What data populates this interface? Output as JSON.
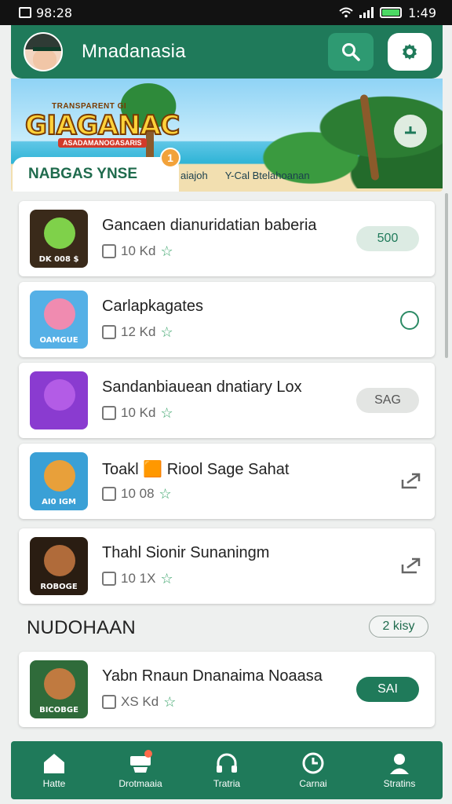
{
  "status_bar": {
    "time": "98:28",
    "battery_time": "1:49"
  },
  "app_bar": {
    "title": "Mnadanasia",
    "avatar_icon": "avatar",
    "search_icon": "search-icon",
    "settings_icon": "gear-icon"
  },
  "banner": {
    "logo_small": "TRANSPARENT GI",
    "logo_big": "GIAGANAC",
    "logo_ribbon": "ASADAMANOGASARIS",
    "tab_label": "NABGAS YNSE",
    "tab_badge": "1",
    "caption_1": "aiajoh",
    "caption_2": "Y-Cal Btelahoanan"
  },
  "items": [
    {
      "title": "Gancaen dianuridatian baberia",
      "meta": "10 Kd",
      "action_type": "pill",
      "action_label": "500",
      "thumb_caption": "DK 008 $",
      "thumb_bg": "#3a2a1a",
      "creature": "#7fd14a"
    },
    {
      "title": "Carlapkagates",
      "meta": "12 Kd",
      "action_type": "radio",
      "action_label": "",
      "thumb_caption": "OAMGUE",
      "thumb_bg": "#55b0e6",
      "creature": "#f08bb0"
    },
    {
      "title": "Sandanbiauean dnatiary Lox",
      "meta": "10 Kd",
      "action_type": "pill",
      "action_label": "SAG",
      "thumb_caption": "",
      "thumb_bg": "#8a3bd0",
      "creature": "#b35ce6"
    },
    {
      "title": "Toakl 🟧 Riool Sage Sahat",
      "meta": "10 08",
      "action_type": "share",
      "action_label": "",
      "thumb_caption": "AI0 IGM",
      "thumb_bg": "#3aa0d6",
      "creature": "#e8a03a"
    },
    {
      "title": "Thahl Sionir Sunaningm",
      "meta": "10 1X",
      "action_type": "share",
      "action_label": "",
      "thumb_caption": "ROBOGE",
      "thumb_bg": "#2a1d12",
      "creature": "#b06b3a"
    }
  ],
  "section": {
    "title": "NUDOHAAN",
    "chip": "2 kisy"
  },
  "section_items": [
    {
      "title": "Yabn Rnaun Dnanaima Noaasa",
      "meta": "XS Kd",
      "action_type": "pill",
      "action_label": "SAI",
      "thumb_caption": "BICOBGE",
      "thumb_bg": "#2f6b3a",
      "creature": "#c07a40"
    }
  ],
  "nav": [
    {
      "label": "Hatte",
      "icon": "home-icon"
    },
    {
      "label": "Drotmaaia",
      "icon": "inbox-icon"
    },
    {
      "label": "Tratria",
      "icon": "headset-icon"
    },
    {
      "label": "Carnai",
      "icon": "clock-icon"
    },
    {
      "label": "Stratins",
      "icon": "profile-icon"
    }
  ],
  "colors": {
    "primary": "#1f7a5a",
    "accent": "#2e9a72",
    "pill_green": "#1f7a5a",
    "pill_light": "#dcebe3",
    "pill_gray": "#e3e5e3"
  }
}
